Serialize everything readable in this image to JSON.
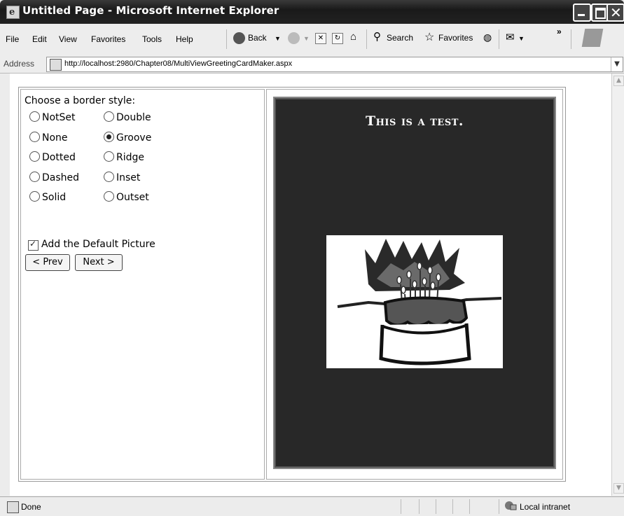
{
  "window": {
    "title": "Untitled Page - Microsoft Internet Explorer"
  },
  "menu": [
    "File",
    "Edit",
    "View",
    "Favorites",
    "Tools",
    "Help"
  ],
  "toolbar": {
    "back": "Back",
    "search": "Search",
    "favorites": "Favorites",
    "chevron": "»"
  },
  "address": {
    "label": "Address",
    "url": "http://localhost:2980/Chapter08/MultiViewGreetingCardMaker.aspx"
  },
  "form": {
    "legend": "Choose a border style:",
    "options_left": [
      "NotSet",
      "None",
      "Dotted",
      "Dashed",
      "Solid"
    ],
    "options_right": [
      "Double",
      "Groove",
      "Ridge",
      "Inset",
      "Outset"
    ],
    "selected": "Groove",
    "checkbox_label": "Add the Default Picture",
    "checkbox_checked": true,
    "prev_label": "< Prev",
    "next_label": "Next >"
  },
  "card": {
    "text": "This is a test."
  },
  "status": {
    "text": "Done",
    "zone": "Local intranet"
  },
  "colors": {
    "title_bar": "#1f1f1f",
    "card_bg": "#282828",
    "card_text": "#ffffff"
  }
}
